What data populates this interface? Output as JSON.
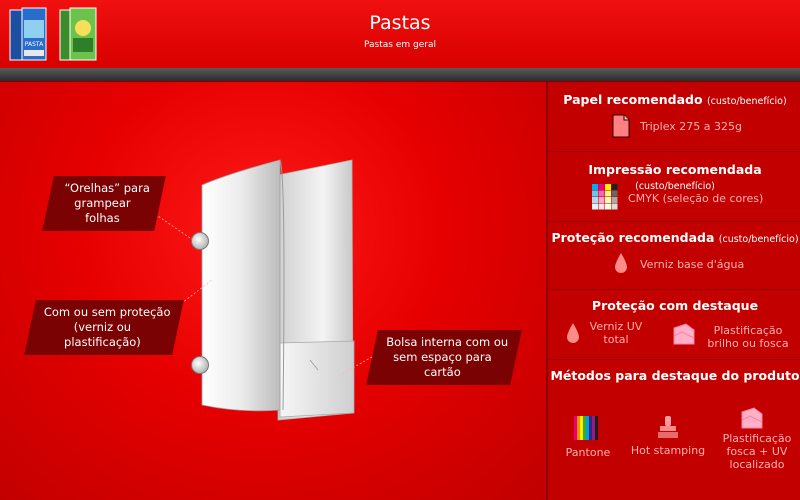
{
  "header": {
    "title": "Pastas",
    "subtitle": "Pastas em geral",
    "thumb1_word": "PASTA"
  },
  "callouts": {
    "orelhas_line1": "“Orelhas” para",
    "orelhas_line2": "grampear folhas",
    "protecao_line1": "Com ou sem proteção",
    "protecao_line2": "(verniz ou plastificação)",
    "bolsa_line1": "Bolsa interna com ou",
    "bolsa_line2": "sem espaço para cartão"
  },
  "panel": {
    "papel": {
      "title": "Papel recomendado",
      "note": "(custo/benefício)",
      "item": "Triplex 275 a 325g"
    },
    "impressao": {
      "title": "Impressão recomendada",
      "note": "(custo/benefício)",
      "item": "CMYK (seleção de cores)"
    },
    "protecao": {
      "title": "Proteção recomendada",
      "note": "(custo/benefício)",
      "item": "Verniz base d'água"
    },
    "destaque": {
      "title": "Proteção com destaque",
      "item1_line1": "Verniz UV",
      "item1_line2": "total",
      "item2_line1": "Plastificação",
      "item2_line2": "brilho ou fosca"
    },
    "metodos": {
      "title": "Métodos para destaque do produto",
      "item1": "Pantone",
      "item2": "Hot stamping",
      "item3_line1": "Plastificação",
      "item3_line2": "fosca + UV",
      "item3_line3": "localizado"
    }
  },
  "colors": {
    "accent_red": "#e60000",
    "panel_red": "#c30000",
    "callout_dark": "#7a0202",
    "item_text_pink": "#ffb0b0"
  },
  "icons": [
    "folder-thumb-icon",
    "paper-sheet-icon",
    "cmyk-swatch-icon",
    "water-drop-icon",
    "lamination-icon",
    "pantone-icon",
    "stamp-icon"
  ]
}
